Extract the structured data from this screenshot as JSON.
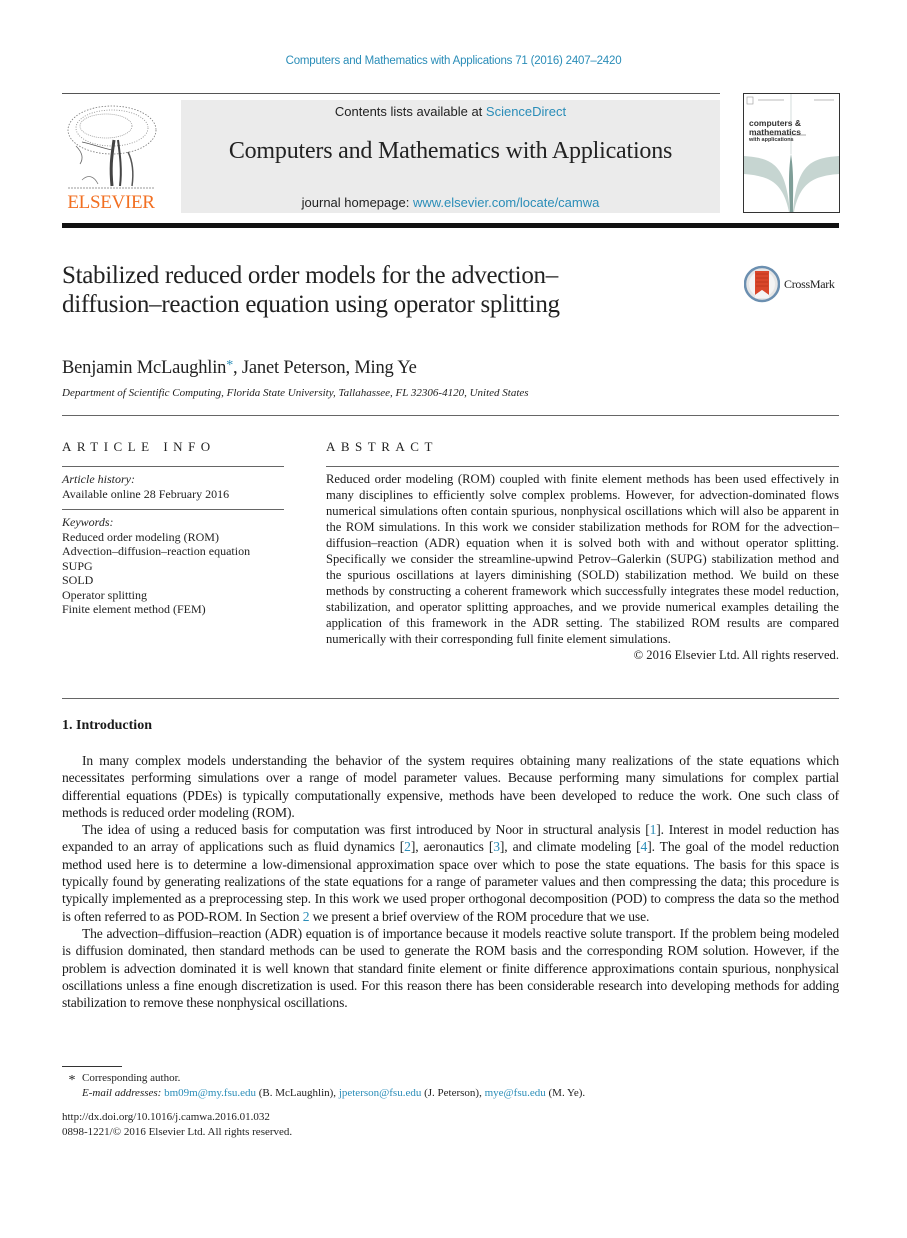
{
  "header": {
    "citation": "Computers and Mathematics with Applications 71 (2016) 2407–2420",
    "contents_prefix": "Contents lists available at ",
    "contents_link": "ScienceDirect",
    "journal_title": "Computers and Mathematics with Applications",
    "homepage_prefix": "journal homepage: ",
    "homepage_link": "www.elsevier.com/locate/camwa",
    "publisher_logo_text": "ELSEVIER",
    "cover": {
      "line1": "computers &",
      "line2": "mathematics",
      "line3": "with applications"
    }
  },
  "article": {
    "title": "Stabilized reduced order models for the advection–diffusion–reaction equation using operator splitting",
    "crossmark_label": "CrossMark",
    "authors": [
      {
        "name": "Benjamin McLaughlin",
        "marker": "*"
      },
      {
        "name": "Janet Peterson",
        "marker": ""
      },
      {
        "name": "Ming Ye",
        "marker": ""
      }
    ],
    "affiliation": "Department of Scientific Computing, Florida State University, Tallahassee, FL 32306-4120, United States"
  },
  "article_info": {
    "heading": "ARTICLE INFO",
    "history_label": "Article history:",
    "history_value": "Available online 28 February 2016",
    "keywords_label": "Keywords:",
    "keywords": [
      "Reduced order modeling (ROM)",
      "Advection–diffusion–reaction equation",
      "SUPG",
      "SOLD",
      "Operator splitting",
      "Finite element method (FEM)"
    ]
  },
  "abstract": {
    "heading": "ABSTRACT",
    "text": "Reduced order modeling (ROM) coupled with finite element methods has been used effec­tively in many disciplines to efficiently solve complex problems. However, for advection-dominated flows numerical simulations often contain spurious, nonphysical oscillations which will also be apparent in the ROM simulations. In this work we consider stabilization methods for ROM for the advection–diffusion–reaction (ADR) equation when it is solved both with and without operator splitting. Specifically we consider the streamline-upwind Petrov–Galerkin (SUPG) stabilization method and the spurious oscillations at layers dimin­ishing (SOLD) stabilization method. We build on these methods by constructing a coherent framework which successfully integrates these model reduction, stabilization, and opera­tor splitting approaches, and we provide numerical examples detailing the application of this framework in the ADR setting. The stabilized ROM results are compared numerically with their corresponding full finite element simulations.",
    "copyright": "© 2016 Elsevier Ltd. All rights reserved."
  },
  "introduction": {
    "heading": "1.  Introduction",
    "p1": "In many complex models understanding the behavior of the system requires obtaining many realizations of the state equations which necessitates performing simulations over a range of model parameter values. Because performing many simulations for complex partial differential equations (PDEs) is typically computationally expensive, methods have been developed to reduce the work. One such class of methods is reduced order modeling (ROM).",
    "p2": {
      "a": "The idea of using a reduced basis for computation was first introduced by Noor in structural analysis [",
      "ref1": "1",
      "b": "]. Interest in model reduction has expanded to an array of applications such as fluid dynamics [",
      "ref2": "2",
      "c": "], aeronautics [",
      "ref3": "3",
      "d": "], and climate modeling [",
      "ref4": "4",
      "e": "]. The goal of the model reduction method used here is to determine a low-dimensional approximation space over which to pose the state equations. The basis for this space is typically found by generating realizations of the state equations for a range of parameter values and then compressing the data; this procedure is typically implemented as a preprocessing step. In this work we used proper orthogonal decomposition (POD) to compress the data so the method is often referred to as POD-ROM. In Section ",
      "section_ref": "2",
      "f": " we present a brief overview of the ROM procedure that we use."
    },
    "p3": "The advection–diffusion–reaction (ADR) equation is of importance because it models reactive solute transport. If the problem being modeled is diffusion dominated, then standard methods can be used to generate the ROM basis and the corresponding ROM solution. However, if the problem is advection dominated it is well known that standard finite element or finite difference approximations contain spurious, nonphysical oscillations unless a fine enough discretization is used. For this reason there has been considerable research into developing methods for adding stabilization to remove these nonphysical oscillations."
  },
  "footnotes": {
    "marker": "*",
    "corresponding": "Corresponding author.",
    "email_label": "E-mail addresses: ",
    "emails": [
      {
        "address": "bm09m@my.fsu.edu",
        "owner": " (B. McLaughlin), "
      },
      {
        "address": "jpeterson@fsu.edu",
        "owner": " (J. Peterson), "
      },
      {
        "address": "mye@fsu.edu",
        "owner": " (M. Ye)."
      }
    ],
    "doi": "http://dx.doi.org/10.1016/j.camwa.2016.01.032",
    "issn_copyright": "0898-1221/© 2016 Elsevier Ltd. All rights reserved."
  }
}
